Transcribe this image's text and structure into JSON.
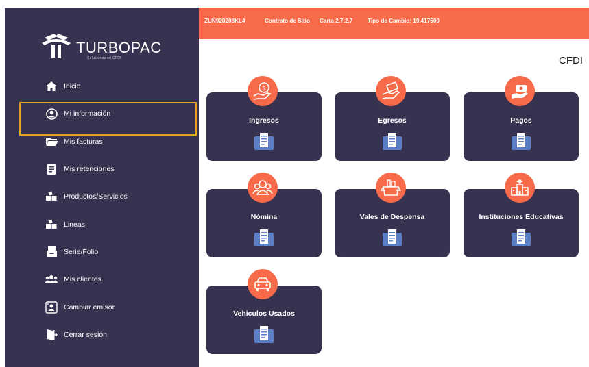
{
  "app": {
    "name": "TURBOPAC",
    "tagline": "Soluciones en CFDI"
  },
  "colors": {
    "sidebar": "#36324f",
    "accent": "#f86b4a",
    "active_border": "#e6a21a"
  },
  "topbar": {
    "rfc": "ZUÑ920208KL4",
    "contract": "Contrato de Sitio",
    "version": "Carta 2.7.2.7",
    "exchange": "Tipo de Cambio: 19.417500"
  },
  "page_title": "CFDI",
  "sidebar": {
    "items": [
      {
        "label": "Inicio",
        "icon": "home-icon",
        "active": false
      },
      {
        "label": "Mi información",
        "icon": "user-circle-icon",
        "active": true
      },
      {
        "label": "Mis facturas",
        "icon": "folder-icon",
        "active": false
      },
      {
        "label": "Mis retenciones",
        "icon": "document-icon",
        "active": false
      },
      {
        "label": "Productos/Servicios",
        "icon": "boxes-icon",
        "active": false
      },
      {
        "label": "Lineas",
        "icon": "boxes-icon",
        "active": false
      },
      {
        "label": "Serie/Folio",
        "icon": "file-drawer-icon",
        "active": false
      },
      {
        "label": "Mis clientes",
        "icon": "users-icon",
        "active": false
      },
      {
        "label": "Cambiar emisor",
        "icon": "switch-user-icon",
        "active": false
      },
      {
        "label": "Cerrar sesión",
        "icon": "logout-door-icon",
        "active": false
      }
    ]
  },
  "cards": [
    {
      "label": "Ingresos",
      "icon": "money-bag-hand-icon"
    },
    {
      "label": "Egresos",
      "icon": "paying-hand-icon"
    },
    {
      "label": "Pagos",
      "icon": "payment-hand-icon"
    },
    {
      "label": "Nómina",
      "icon": "team-icon"
    },
    {
      "label": "Vales de Despensa",
      "icon": "grocery-box-icon"
    },
    {
      "label": "Instituciones Educativas",
      "icon": "school-icon"
    },
    {
      "label": "Vehiculos Usados",
      "icon": "car-icon"
    }
  ]
}
